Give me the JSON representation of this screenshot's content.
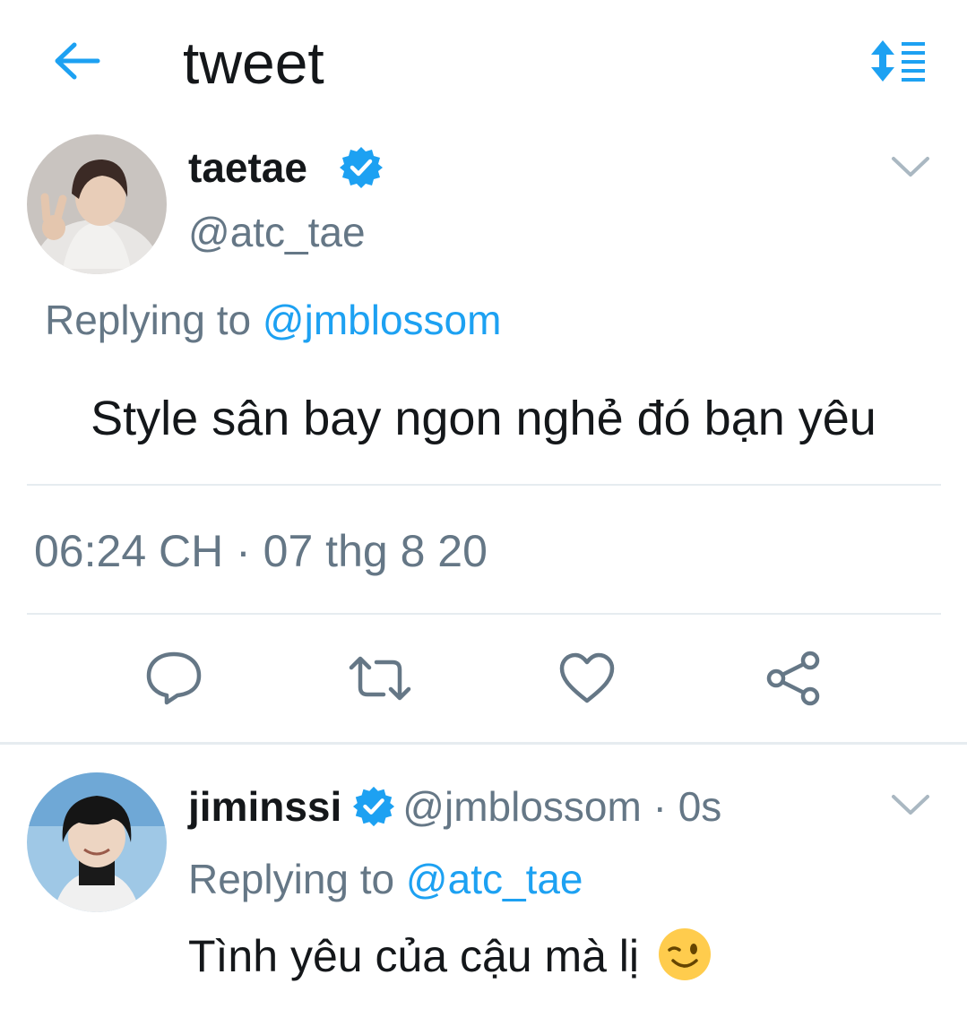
{
  "header": {
    "title": "tweet",
    "back_icon": "arrow-left-icon",
    "sort_icon": "sort-list-icon"
  },
  "main_tweet": {
    "display_name": "taetae",
    "handle": "@atc_tae",
    "verified": true,
    "replying_prefix": "Replying to",
    "replying_to": "@jmblossom",
    "text": "Style sân bay ngon nghẻ đó bạn yêu",
    "timestamp": "06:24 CH · 07 thg 8 20"
  },
  "actions": [
    {
      "name": "reply-button",
      "icon": "speech-bubble-icon"
    },
    {
      "name": "retweet-button",
      "icon": "retweet-icon"
    },
    {
      "name": "like-button",
      "icon": "heart-icon"
    },
    {
      "name": "share-button",
      "icon": "share-icon"
    }
  ],
  "reply_tweet": {
    "display_name": "jiminssi",
    "handle_time": "@jmblossom · 0s",
    "verified": true,
    "replying_prefix": "Replying to",
    "replying_to": "@atc_tae",
    "text": "Tình yêu của cậu mà lị",
    "emoji": "winking-face-emoji"
  },
  "colors": {
    "accent": "#1da1f2",
    "secondary_text": "#657786",
    "primary_text": "#14171a",
    "divider": "#e6ecf0"
  }
}
